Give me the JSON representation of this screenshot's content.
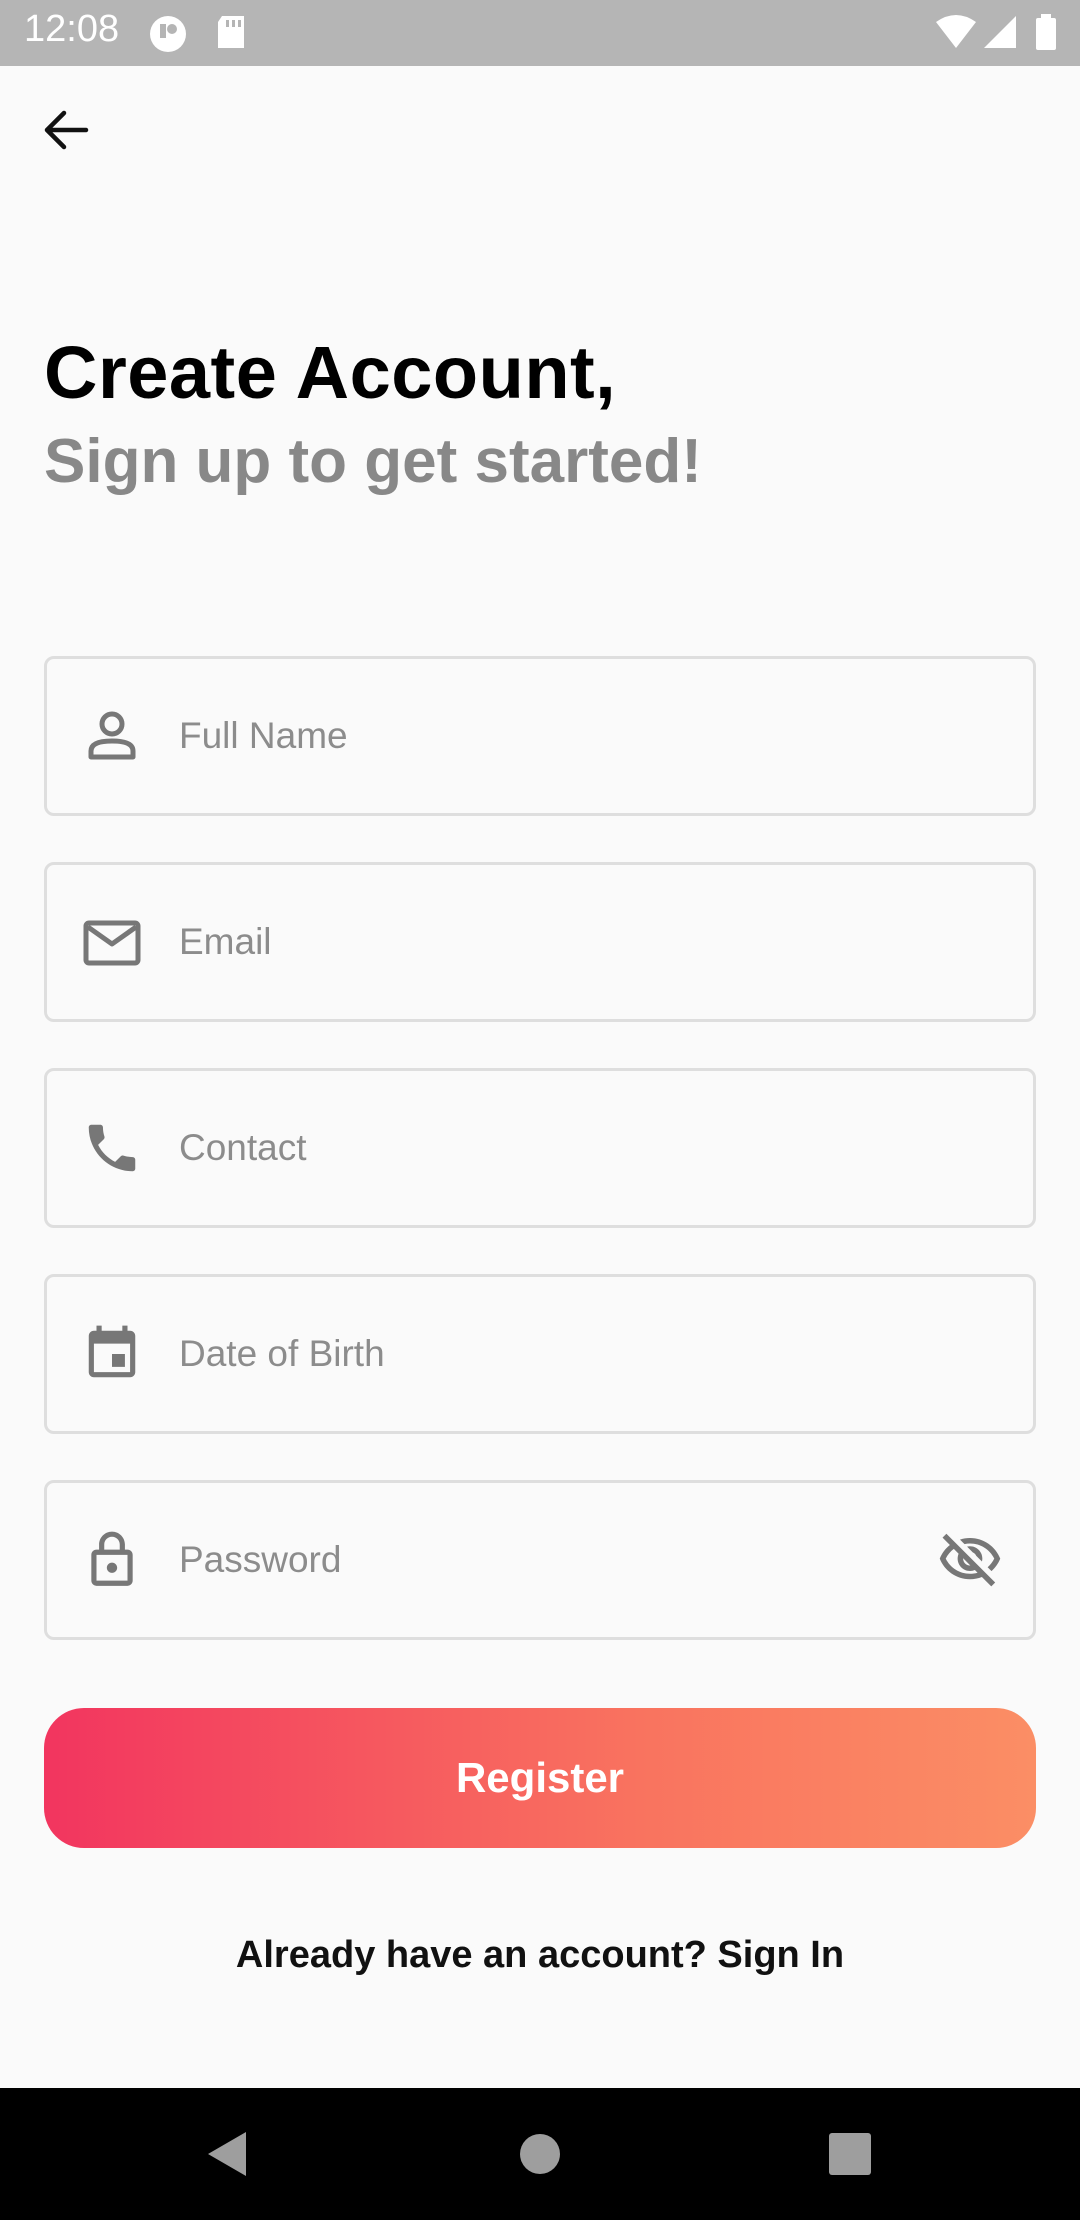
{
  "status_bar": {
    "time": "12:08",
    "icons": [
      "notification-app-icon",
      "sd-card-icon",
      "wifi-icon",
      "signal-icon",
      "battery-icon"
    ]
  },
  "header": {
    "back_icon": "arrow-back-icon"
  },
  "title": "Create Account,",
  "subtitle": "Sign up to get started!",
  "form": {
    "full_name": {
      "placeholder": "Full Name",
      "icon": "person-icon"
    },
    "email": {
      "placeholder": "Email",
      "icon": "mail-icon"
    },
    "contact": {
      "placeholder": "Contact",
      "icon": "phone-icon"
    },
    "dob": {
      "placeholder": "Date of Birth",
      "icon": "calendar-icon"
    },
    "password": {
      "placeholder": "Password",
      "icon": "lock-icon",
      "toggle_icon": "visibility-off-icon"
    }
  },
  "register_label": "Register",
  "signin_text": "Already have an account? Sign In",
  "colors": {
    "gradient_start": "#f2355f",
    "gradient_end": "#fb8e65",
    "field_border": "#dedede",
    "placeholder": "#8c8c8c"
  },
  "nav_bar": {
    "icons": [
      "nav-back-icon",
      "nav-home-icon",
      "nav-recents-icon"
    ]
  }
}
